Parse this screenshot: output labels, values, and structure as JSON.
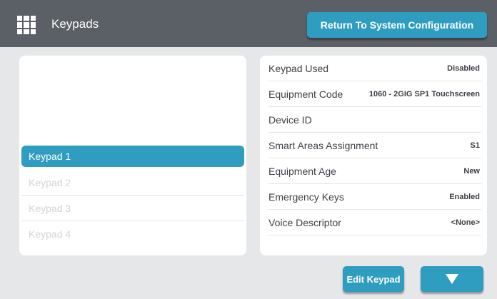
{
  "header": {
    "title": "Keypads",
    "icon": "grid-icon",
    "return_button": "Return To System Configuration"
  },
  "keypad_list": {
    "items": [
      {
        "label": "Keypad 1",
        "selected": true
      },
      {
        "label": "Keypad 2",
        "selected": false
      },
      {
        "label": "Keypad 3",
        "selected": false
      },
      {
        "label": "Keypad 4",
        "selected": false
      }
    ]
  },
  "details": {
    "rows": [
      {
        "label": "Keypad Used",
        "value": "Disabled"
      },
      {
        "label": "Equipment Code",
        "value": "1060 - 2GIG SP1 Touchscreen"
      },
      {
        "label": "Device ID",
        "value": ""
      },
      {
        "label": "Smart Areas Assignment",
        "value": "S1"
      },
      {
        "label": "Equipment Age",
        "value": "New"
      },
      {
        "label": "Emergency Keys",
        "value": "Enabled"
      },
      {
        "label": "Voice Descriptor",
        "value": "<None>"
      }
    ]
  },
  "footer": {
    "edit_button": "Edit Keypad",
    "down_button_icon": "triangle-down-icon"
  },
  "colors": {
    "header_bg": "#5b5f66",
    "accent": "#2f9dc0",
    "page_bg": "#e6e7e8"
  }
}
